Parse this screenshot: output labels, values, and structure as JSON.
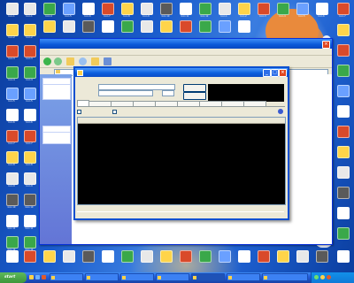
{
  "desktop": {
    "icons": [
      {
        "label": "Icon 1",
        "color": "#e8e8e8"
      },
      {
        "label": "Icon 2",
        "color": "#ffd44a"
      },
      {
        "label": "Icon 3",
        "color": "#d94a2a"
      },
      {
        "label": "Icon 4",
        "color": "#3aa84a"
      },
      {
        "label": "Icon 5",
        "color": "#6aa0ff"
      },
      {
        "label": "Icon 6",
        "color": "#ffffff"
      },
      {
        "label": "Icon 7",
        "color": "#d94a2a"
      },
      {
        "label": "Icon 8",
        "color": "#ffd44a"
      },
      {
        "label": "Icon 9",
        "color": "#e8e8e8"
      },
      {
        "label": "Icon 10",
        "color": "#5a5a5a"
      },
      {
        "label": "Icon 11",
        "color": "#ffffff"
      },
      {
        "label": "Icon 12",
        "color": "#3aa84a"
      }
    ]
  },
  "explorer": {
    "title": "",
    "menu": "",
    "address_label": "",
    "address": "",
    "tasks": [
      {
        "header": "",
        "items": [
          "",
          "",
          "",
          ""
        ]
      },
      {
        "header": "",
        "items": [
          "",
          "",
          ""
        ]
      }
    ]
  },
  "app": {
    "title": "",
    "menu": [
      "",
      "",
      ""
    ],
    "search_label": "",
    "search_value": "",
    "filter_label": "",
    "filter_value": "",
    "search_button": "",
    "stop_button": "",
    "stats": [
      "",
      "",
      "",
      "",
      "",
      ""
    ],
    "tabs": [
      "",
      "",
      "",
      "",
      "",
      "",
      "",
      "",
      ""
    ],
    "options": [
      "",
      "",
      "",
      "",
      ""
    ],
    "columns": [
      "",
      "",
      "",
      "",
      "",
      "",
      ""
    ],
    "status": "",
    "grid_rows": []
  },
  "taskbar": {
    "start_label": "start",
    "buttons": [
      "",
      "",
      "",
      "",
      "",
      "",
      ""
    ],
    "clock": ""
  }
}
